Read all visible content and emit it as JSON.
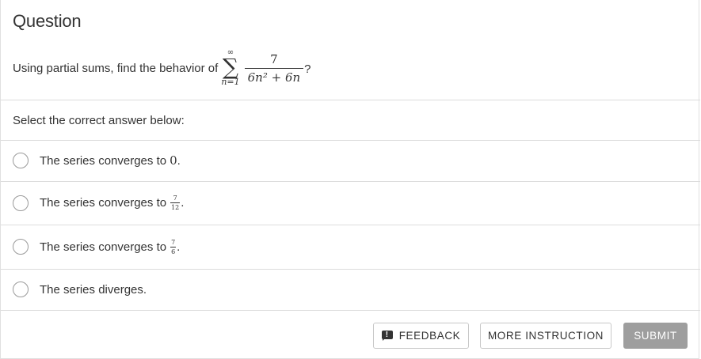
{
  "question": {
    "title": "Question",
    "text": "Using partial sums, find the behavior of",
    "sum_upper": "∞",
    "sum_symbol": "∑",
    "sum_lower": "n=1",
    "numerator": "7",
    "denominator": "6n² + 6n",
    "question_mark": "?"
  },
  "prompt": "Select the correct answer below:",
  "options": [
    {
      "prefix": "The series converges to",
      "value": "0",
      "suffix": "."
    },
    {
      "prefix": "The series converges to",
      "num": "7",
      "den": "12",
      "suffix": "."
    },
    {
      "prefix": "The series converges to",
      "num": "7",
      "den": "6",
      "suffix": "."
    },
    {
      "prefix": "The series diverges.",
      "suffix": ""
    }
  ],
  "buttons": {
    "feedback": "FEEDBACK",
    "more_instruction": "MORE INSTRUCTION",
    "submit": "SUBMIT"
  },
  "colors": {
    "divider": "#dcdcdc",
    "submit_bg": "#9e9e9e",
    "text": "#333333"
  }
}
